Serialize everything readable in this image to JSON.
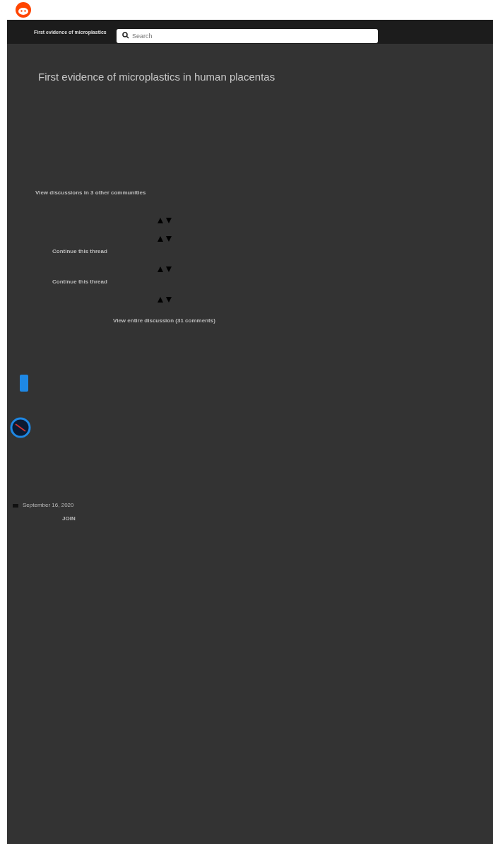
{
  "header": {
    "title": "First evidence of microplastics",
    "search": {
      "placeholder": "Search"
    }
  },
  "post": {
    "title": "First evidence of microplastics in human placentas",
    "other_discussions": "View discussions in 3 other communities"
  },
  "threads": [
    {
      "kind": "comment"
    },
    {
      "kind": "reply",
      "link": "Continue this thread"
    },
    {
      "kind": "reply",
      "link": "Continue this thread"
    },
    {
      "kind": "reply"
    }
  ],
  "view_all": "View entire discussion (31 comments)",
  "community": {
    "date": "September 16, 2020",
    "join": "JOIN"
  }
}
